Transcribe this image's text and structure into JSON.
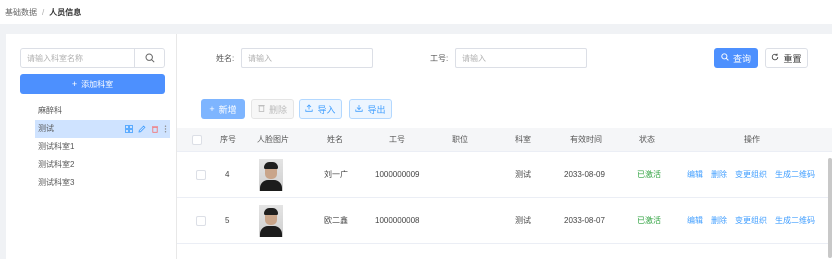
{
  "breadcrumb": {
    "root": "基础数据",
    "separator": "/",
    "current": "人员信息"
  },
  "sidebar": {
    "search_placeholder": "请输入科室名称",
    "add_label": "添加科室",
    "items": [
      {
        "label": "麻醉科"
      },
      {
        "label": "测试",
        "active": true
      },
      {
        "label": "测试科室1"
      },
      {
        "label": "测试科室2"
      },
      {
        "label": "测试科室3"
      }
    ]
  },
  "filters": {
    "name_label": "姓名:",
    "name_placeholder": "请输入",
    "id_label": "工号:",
    "id_placeholder": "请输入",
    "query_label": "查询",
    "reset_label": "重置"
  },
  "toolbar": {
    "add_label": "新增",
    "delete_label": "删除",
    "import_label": "导入",
    "export_label": "导出"
  },
  "table": {
    "columns": {
      "index": "序号",
      "photo": "人脸图片",
      "name": "姓名",
      "id": "工号",
      "position": "职位",
      "dept": "科室",
      "valid": "有效时间",
      "status": "状态",
      "ops": "操作"
    },
    "rows": [
      {
        "index": "4",
        "name": "刘一广",
        "id": "1000000009",
        "position": "",
        "dept": "测试",
        "valid": "2033-08-09",
        "status": "已激活"
      },
      {
        "index": "5",
        "name": "欧二鑫",
        "id": "1000000008",
        "position": "",
        "dept": "测试",
        "valid": "2033-08-07",
        "status": "已激活"
      }
    ],
    "ops": {
      "edit": "编辑",
      "delete": "删除",
      "change_org": "变更组织",
      "qrcode": "生成二维码"
    }
  },
  "colors": {
    "primary": "#4d90fe",
    "active_status": "#2ea23f",
    "link": "#409eff",
    "tree_active_bg": "#cfe3ff"
  },
  "icons": {
    "search": "search-icon",
    "refresh": "refresh-icon",
    "plus": "plus-icon",
    "trash": "trash-icon",
    "upload": "upload-icon",
    "download": "download-icon"
  }
}
